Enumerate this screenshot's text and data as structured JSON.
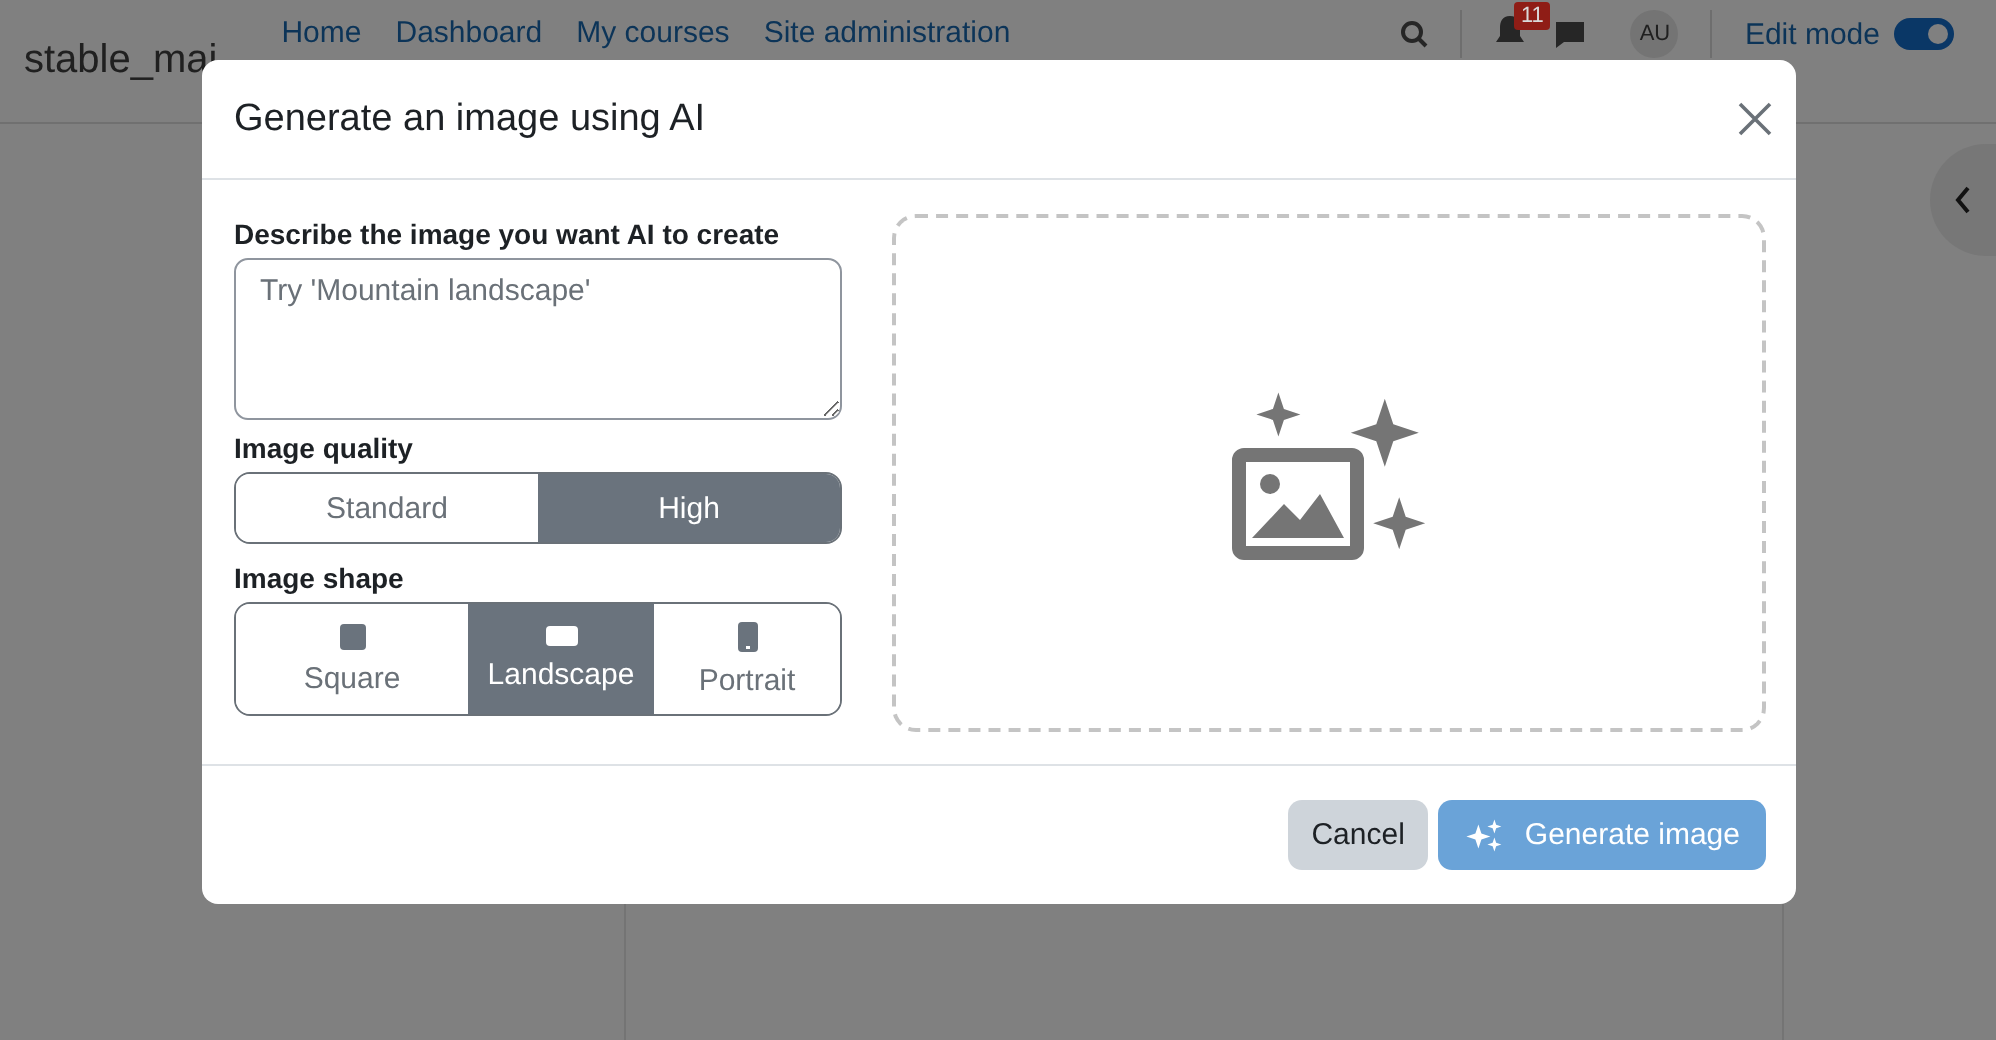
{
  "background": {
    "site_name": "stable_mai",
    "nav": [
      {
        "label": "Home"
      },
      {
        "label": "Dashboard"
      },
      {
        "label": "My courses"
      },
      {
        "label": "Site administration"
      }
    ],
    "notification_count": "11",
    "avatar": "AU",
    "edit_mode": {
      "label": "Edit mode",
      "on": true
    }
  },
  "dialog": {
    "title": "Generate an image using AI",
    "prompt": {
      "label": "Describe the image you want AI to create",
      "placeholder": "Try 'Mountain landscape'"
    },
    "quality": {
      "label": "Image quality",
      "options": [
        {
          "label": "Standard",
          "selected": false
        },
        {
          "label": "High",
          "selected": true
        }
      ]
    },
    "shape": {
      "label": "Image shape",
      "options": [
        {
          "kind": "square",
          "label": "Square",
          "selected": false
        },
        {
          "kind": "landscape",
          "label": "Landscape",
          "selected": true
        },
        {
          "kind": "portrait",
          "label": "Portrait",
          "selected": false
        }
      ]
    },
    "buttons": [
      {
        "kind": "cancel",
        "label": "Cancel"
      },
      {
        "kind": "generate",
        "label": "Generate image"
      }
    ]
  }
}
